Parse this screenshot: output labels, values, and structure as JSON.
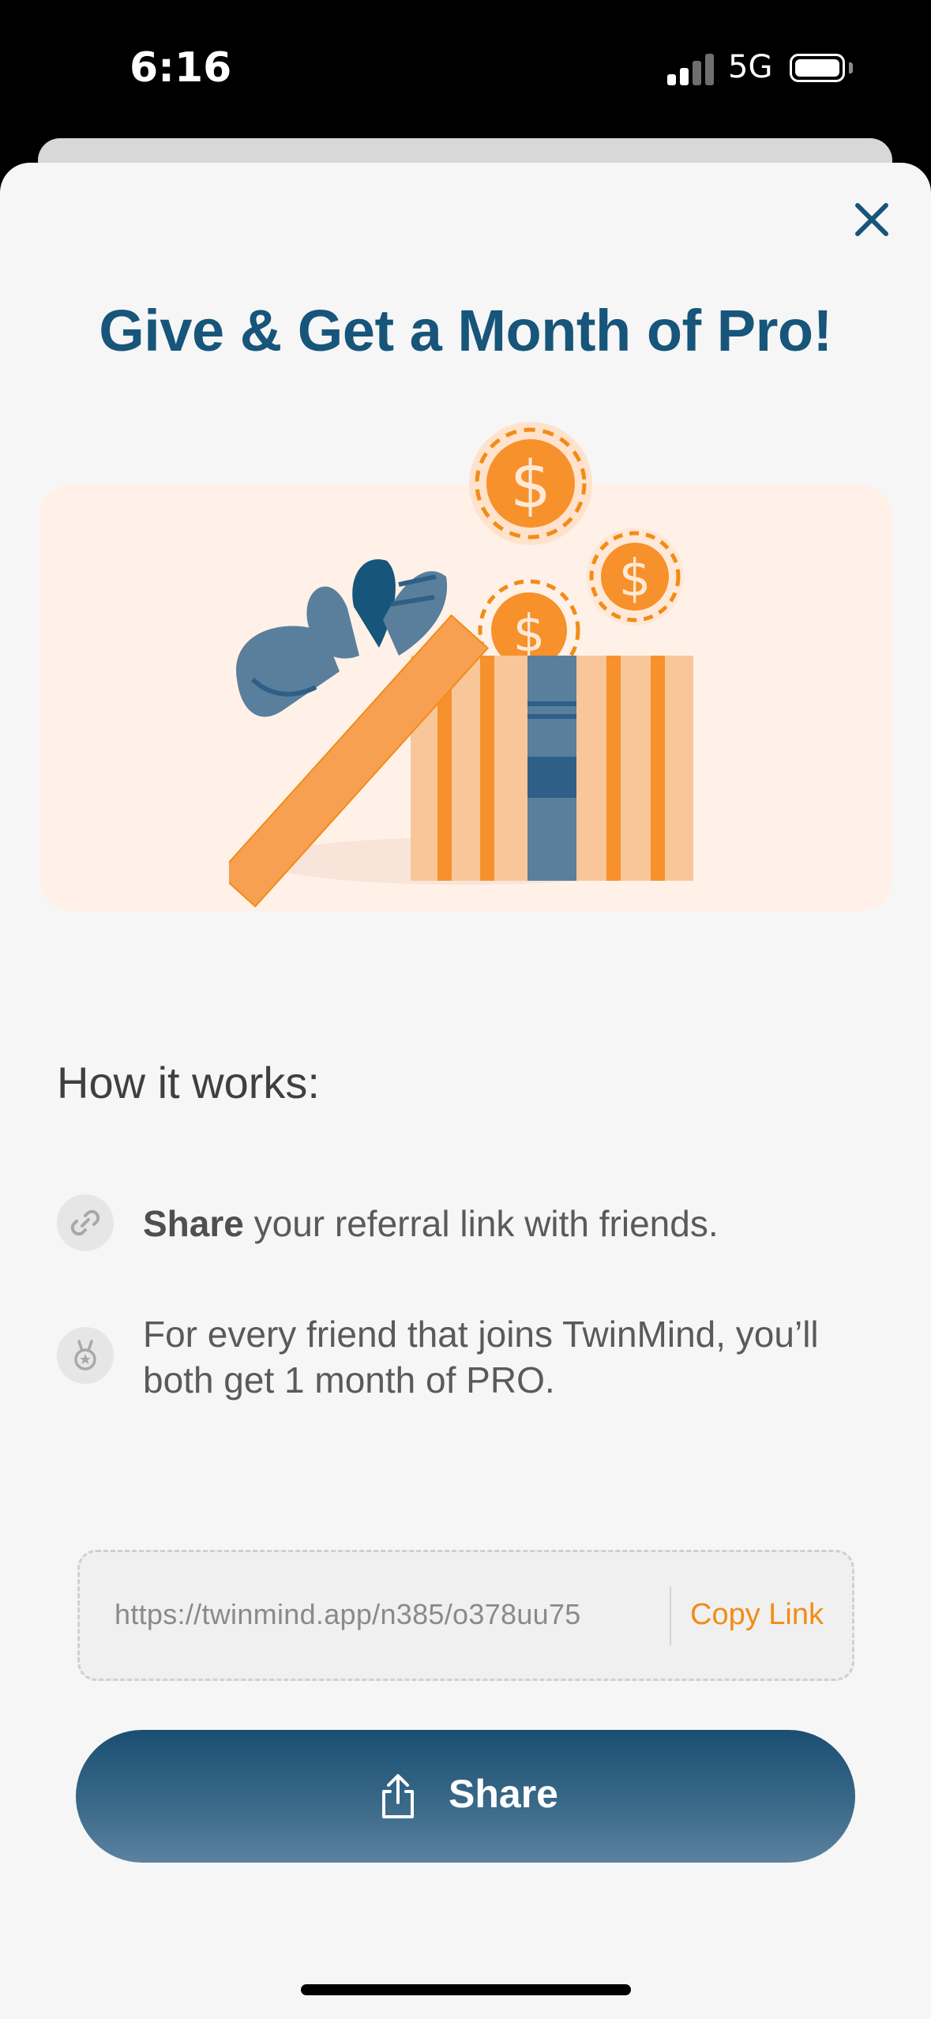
{
  "status_bar": {
    "time": "6:16",
    "network": "5G"
  },
  "modal": {
    "title": "Give & Get a Month of Pro!",
    "close_icon": "close-icon",
    "illustration": "gift-box-with-coins",
    "how_it_works": {
      "heading": "How it works:",
      "steps": [
        {
          "icon": "link-icon",
          "bold": "Share",
          "text": " your referral link with friends."
        },
        {
          "icon": "medal-icon",
          "line1": "For every friend that joins TwinMind, you’ll",
          "line2": "both get 1 month of PRO."
        }
      ]
    },
    "referral": {
      "url": "https://twinmind.app/n385/o378uu75",
      "copy_label": "Copy Link"
    },
    "share_button": {
      "label": "Share",
      "icon": "share-icon"
    }
  },
  "colors": {
    "title": "#17557a",
    "accent_orange": "#f28c16",
    "banner_bg": "#fff1e8",
    "sheet_bg": "#f6f6f6"
  }
}
